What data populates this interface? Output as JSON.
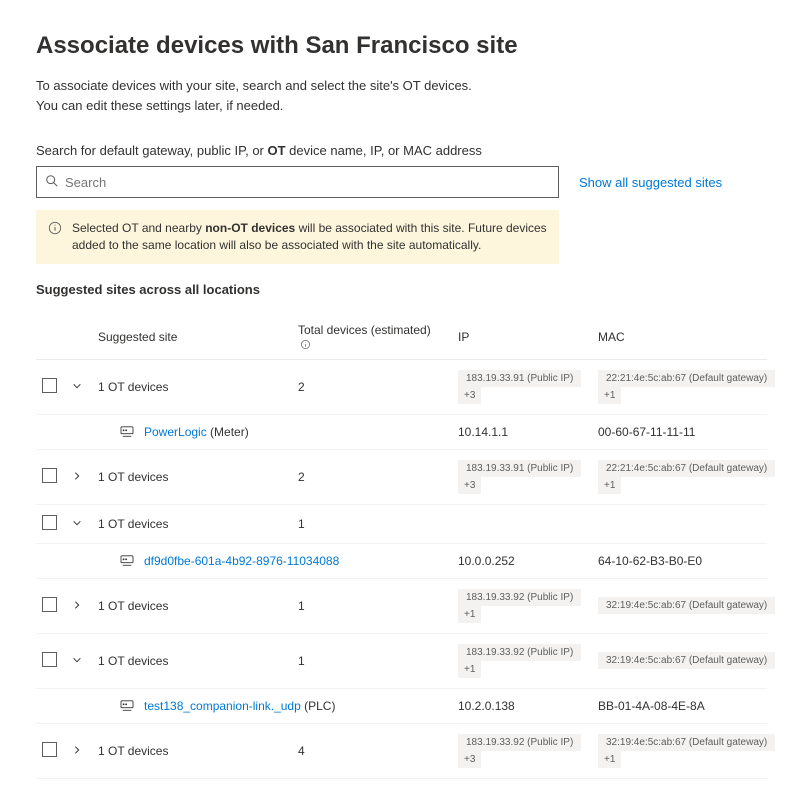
{
  "title": "Associate devices with San Francisco site",
  "intro_line1": "To associate devices with your site, search and select the site's OT devices.",
  "intro_line2": "You can edit these settings later, if needed.",
  "search": {
    "label_before": "Search for default gateway, public IP, or ",
    "label_bold": "OT",
    "label_after": " device name, IP, or MAC address",
    "placeholder": "Search",
    "show_all": "Show all suggested sites"
  },
  "banner": {
    "before": "Selected OT and nearby ",
    "bold": "non-OT devices",
    "after": " will be associated with this site. Future devices added to the same location will also be associated with the site automatically."
  },
  "section_title": "Suggested sites across all locations",
  "columns": {
    "site": "Suggested site",
    "devices": "Total devices (estimated)",
    "ip": "IP",
    "mac": "MAC"
  },
  "rows": [
    {
      "type": "group",
      "expanded": true,
      "site": "1 OT devices",
      "devices": "2",
      "ip_tag": "183.19.33.91 (Public IP)",
      "ip_plus": "+3",
      "mac_tag": "22:21:4e:5c:ab:67 (Default gateway)",
      "mac_plus": "+1"
    },
    {
      "type": "child",
      "name": "PowerLogic",
      "suffix": " (Meter)",
      "ip": "10.14.1.1",
      "mac": "00-60-67-11-11-11"
    },
    {
      "type": "group",
      "expanded": false,
      "site": "1 OT devices",
      "devices": "2",
      "ip_tag": "183.19.33.91 (Public IP)",
      "ip_plus": "+3",
      "mac_tag": "22:21:4e:5c:ab:67 (Default gateway)",
      "mac_plus": "+1"
    },
    {
      "type": "group",
      "expanded": true,
      "site": "1 OT devices",
      "devices": "1",
      "ip_tag": "",
      "ip_plus": "",
      "mac_tag": "",
      "mac_plus": ""
    },
    {
      "type": "child",
      "name": "df9d0fbe-601a-4b92-8976-11034088",
      "suffix": "",
      "ip": "10.0.0.252",
      "mac": "64-10-62-B3-B0-E0"
    },
    {
      "type": "group",
      "expanded": false,
      "site": "1 OT devices",
      "devices": "1",
      "ip_tag": "183.19.33.92 (Public IP)",
      "ip_plus": "+1",
      "mac_tag": "32:19:4e:5c:ab:67 (Default gateway)",
      "mac_plus": ""
    },
    {
      "type": "group",
      "expanded": true,
      "site": "1 OT devices",
      "devices": "1",
      "ip_tag": "183.19.33.92 (Public IP)",
      "ip_plus": "+1",
      "mac_tag": "32:19:4e:5c:ab:67 (Default gateway)",
      "mac_plus": ""
    },
    {
      "type": "child",
      "name": "test138_companion-link._udp",
      "suffix": " (PLC)",
      "ip": "10.2.0.138",
      "mac": "BB-01-4A-08-4E-8A"
    },
    {
      "type": "group",
      "expanded": false,
      "site": "1 OT devices",
      "devices": "4",
      "ip_tag": "183.19.33.92 (Public IP)",
      "ip_plus": "+3",
      "mac_tag": "32:19:4e:5c:ab:67 (Default gateway)",
      "mac_plus": "+1"
    }
  ]
}
